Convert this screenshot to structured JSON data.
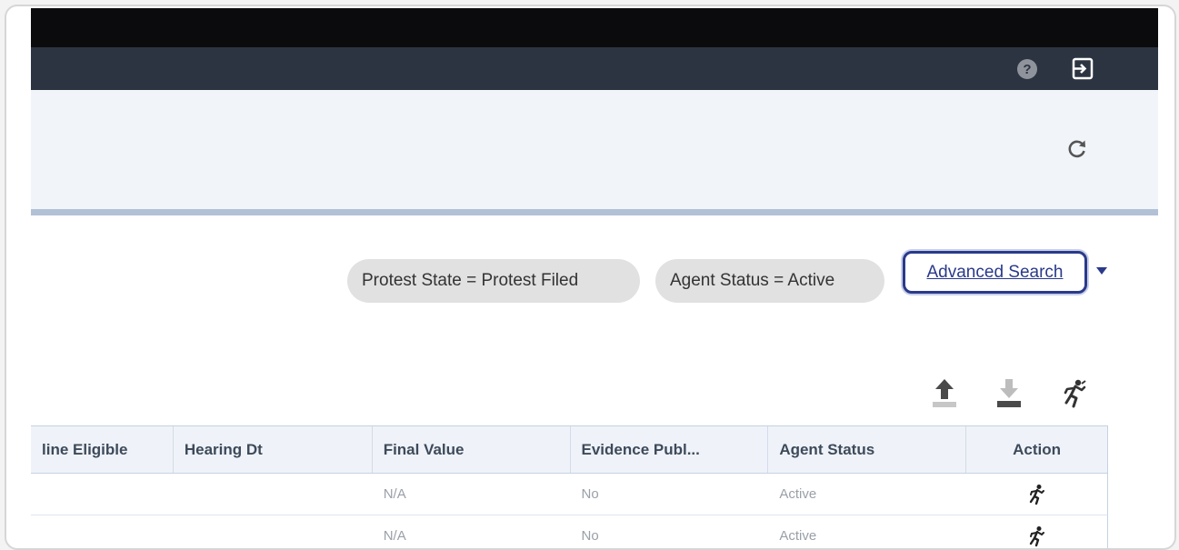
{
  "filters": {
    "chips": [
      {
        "label": "Protest State = Protest Filed"
      },
      {
        "label": "Agent Status = Active"
      }
    ],
    "advanced_search_label": "Advanced Search"
  },
  "header": {
    "help_label": "?"
  },
  "table": {
    "columns": [
      "line Eligible",
      "Hearing Dt",
      "Final Value",
      "Evidence Publ...",
      "Agent Status",
      "Action"
    ],
    "rows": [
      {
        "online_eligible": "",
        "hearing_dt": "",
        "final_value": "N/A",
        "evidence": "No",
        "agent_status": "Active"
      },
      {
        "online_eligible": "",
        "hearing_dt": "",
        "final_value": "N/A",
        "evidence": "No",
        "agent_status": "Active"
      }
    ]
  },
  "icons": {
    "help": "help-icon",
    "logout": "logout-icon",
    "refresh": "refresh-icon",
    "upload": "upload-icon",
    "download": "download-icon",
    "run": "runner-icon"
  },
  "colors": {
    "topbar": "#0b0b0d",
    "navbar": "#2d3441",
    "subheader": "#f1f5fa",
    "accent": "#2a3a8a",
    "chip": "#e1e1e1"
  }
}
